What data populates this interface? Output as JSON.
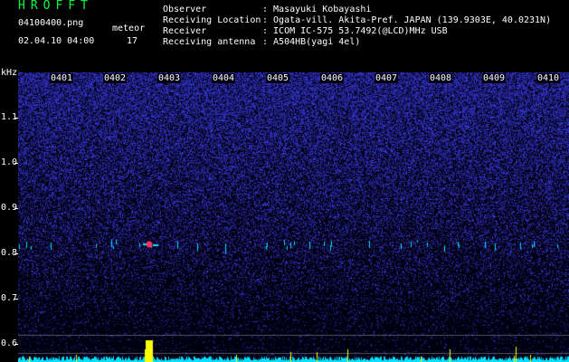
{
  "header": {
    "title": "HROFFT",
    "filename": "04100400.png",
    "meteor_label": "meteor",
    "timestamp": "02.04.10 04:00",
    "meteor_count": "17",
    "info": [
      {
        "label": "Observer",
        "value": ": Masayuki Kobayashi"
      },
      {
        "label": "Receiving Location",
        "value": ": Ogata-vill. Akita-Pref. JAPAN (139.9303E, 40.0231N)"
      },
      {
        "label": "Receiver",
        "value": ": ICOM IC-575 53.7492(@LCD)MHz USB"
      },
      {
        "label": "Receiving antenna",
        "value": ": A504HB(yagi 4el)"
      }
    ]
  },
  "spectrogram": {
    "y_unit": "kHz",
    "y_ticks": [
      "1.1",
      "1.0",
      "0.9",
      "0.8",
      "0.7",
      "0.6"
    ],
    "time_ticks": [
      "0401",
      "0402",
      "0403",
      "0404",
      "0405",
      "0406",
      "0407",
      "0408",
      "0409",
      "0410"
    ],
    "colors": {
      "background": "#000010",
      "noise": "#2a2aa0",
      "meteor": "#ff3060",
      "trace": "#00e0ff",
      "spike": "#ffff00"
    }
  }
}
